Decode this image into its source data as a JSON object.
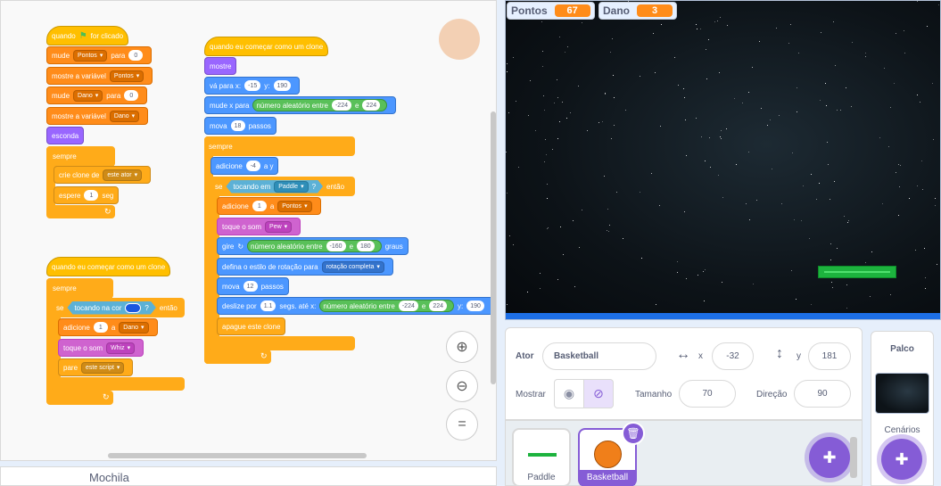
{
  "scripts": {
    "s1": {
      "when_flag": "quando",
      "when_flag_tail": "for clicado",
      "set1": {
        "a": "mude",
        "var": "Pontos",
        "b": "para",
        "val": "0"
      },
      "show1": {
        "a": "mostre a variável",
        "var": "Pontos"
      },
      "set2": {
        "a": "mude",
        "var": "Dano",
        "b": "para",
        "val": "0"
      },
      "show2": {
        "a": "mostre a variável",
        "var": "Dano"
      },
      "hide": "esconda",
      "forever": "sempre",
      "clone": {
        "a": "crie clone de",
        "target": "este ator"
      },
      "wait": {
        "a": "espere",
        "val": "1",
        "b": "seg"
      }
    },
    "s2": {
      "hat": "quando eu começar como um clone",
      "forever": "sempre",
      "if": "se",
      "touch_color": "tocando na cor",
      "q": "?",
      "then": "então",
      "change": {
        "a": "adicione",
        "val": "1",
        "b": "a",
        "var": "Dano"
      },
      "sound": {
        "a": "toque o som",
        "snd": "Whiz"
      },
      "stop": {
        "a": "pare",
        "opt": "este script"
      }
    },
    "s3": {
      "hat": "quando eu começar como um clone",
      "show": "mostre",
      "goto": {
        "a": "vá para x:",
        "x": "-15",
        "b": "y:",
        "y": "190"
      },
      "setx": {
        "a": "mude x para",
        "rand": "número aleatório entre",
        "from": "-224",
        "e": "e",
        "to": "224"
      },
      "move": {
        "a": "mova",
        "val": "18",
        "b": "passos"
      },
      "forever": "sempre",
      "changey": {
        "a": "adicione",
        "val": "-4",
        "b": "a y"
      },
      "if": "se",
      "touching": "tocando em",
      "target": "Paddle",
      "q": "?",
      "then": "então",
      "change": {
        "a": "adicione",
        "val": "1",
        "b": "a",
        "var": "Pontos"
      },
      "sound": {
        "a": "toque o som",
        "snd": "Pew"
      },
      "turn": {
        "a": "gire",
        "rand": "número aleatório entre",
        "from": "-160",
        "e": "e",
        "to": "180",
        "b": "graus"
      },
      "rotstyle": {
        "a": "defina o estilo de rotação para",
        "opt": "rotação completa"
      },
      "move2": {
        "a": "mova",
        "val": "12",
        "b": "passos"
      },
      "glide": {
        "a": "deslize por",
        "secs": "1.1",
        "b": "segs. até x:",
        "rand": "número aleatório entre",
        "from": "-224",
        "e": "e",
        "to": "224",
        "c": "y:",
        "y": "190"
      },
      "delete": "apague este clone"
    }
  },
  "backpack": {
    "label": "Mochila"
  },
  "monitors": {
    "pontos": {
      "label": "Pontos",
      "value": "67"
    },
    "dano": {
      "label": "Dano",
      "value": "3"
    }
  },
  "sprite_info": {
    "sprite_label": "Ator",
    "name": "Basketball",
    "x_label": "x",
    "x": "-32",
    "y_label": "y",
    "y": "181",
    "show_label": "Mostrar",
    "size_label": "Tamanho",
    "size": "70",
    "direction_label": "Direção",
    "direction": "90"
  },
  "sprites": [
    {
      "name": "Paddle"
    },
    {
      "name": "Basketball"
    }
  ],
  "stage_panel": {
    "title": "Palco",
    "backdrops_label": "Cenários"
  },
  "colors": {
    "accent": "#855cd6",
    "events": "#ffbf00",
    "variables": "#ff8c1a",
    "motion": "#4c97ff",
    "looks": "#9966ff",
    "sound": "#cf63cf",
    "control": "#ffab19",
    "operators": "#59c059",
    "sensing": "#5cb1d6"
  }
}
